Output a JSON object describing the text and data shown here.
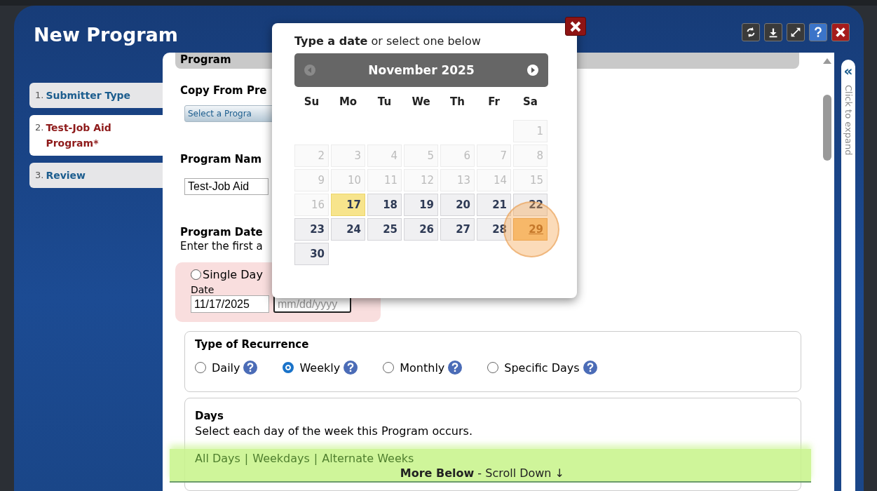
{
  "window": {
    "title": "New Program",
    "toolbar": [
      {
        "kind": "refresh"
      },
      {
        "kind": "download"
      },
      {
        "kind": "resize"
      },
      {
        "kind": "help"
      },
      {
        "kind": "close"
      }
    ]
  },
  "steps": [
    {
      "number": "1.",
      "label": "Submitter Type",
      "selected": false
    },
    {
      "number": "2.",
      "label": "Test-Job Aid Program*",
      "selected": true
    },
    {
      "number": "3.",
      "label": "Review",
      "selected": false
    }
  ],
  "form": {
    "section_title": "Program",
    "copy_from_label": "Copy From Pre",
    "copy_button": "Select a Progra",
    "name_label": "Program Nam",
    "name_value": "Test-Job Aid",
    "dates_label": "Program Date",
    "dates_hint": "Enter the first a",
    "single_day": {
      "label": "Single Day",
      "checked": false
    },
    "date_label": "Date",
    "date_value": "11/17/2025",
    "end_date_placeholder": "mm/dd/yyyy",
    "recurrence": {
      "title": "Type of Recurrence",
      "options": [
        {
          "label": "Daily",
          "selected": false
        },
        {
          "label": "Weekly",
          "selected": true
        },
        {
          "label": "Monthly",
          "selected": false
        },
        {
          "label": "Specific Days",
          "selected": false
        }
      ]
    },
    "days": {
      "title": "Days",
      "hint": "Select each day of the week this Program occurs.",
      "links": [
        "All Days",
        "Weekdays",
        "Alternate Weeks"
      ],
      "separator": "|"
    }
  },
  "scroll_hint": "**More Below** - Scroll Down ↓",
  "side_panel": {
    "icon": "«",
    "label": "Click to expand"
  },
  "date_picker": {
    "prompt": "**Type a date** or select one below",
    "month": "November 2025",
    "weekdays": [
      "Su",
      "Mo",
      "Tu",
      "We",
      "Th",
      "Fr",
      "Sa"
    ],
    "days": [
      {
        "kind": "blank"
      },
      {
        "kind": "blank"
      },
      {
        "kind": "blank"
      },
      {
        "kind": "blank"
      },
      {
        "kind": "blank"
      },
      {
        "kind": "blank"
      },
      {
        "kind": "day",
        "label": "1",
        "disabled": true,
        "today": false,
        "selected": false
      },
      {
        "kind": "day",
        "label": "2",
        "disabled": true,
        "today": false,
        "selected": false
      },
      {
        "kind": "day",
        "label": "3",
        "disabled": true,
        "today": false,
        "selected": false
      },
      {
        "kind": "day",
        "label": "4",
        "disabled": true,
        "today": false,
        "selected": false
      },
      {
        "kind": "day",
        "label": "5",
        "disabled": true,
        "today": false,
        "selected": false
      },
      {
        "kind": "day",
        "label": "6",
        "disabled": true,
        "today": false,
        "selected": false
      },
      {
        "kind": "day",
        "label": "7",
        "disabled": true,
        "today": false,
        "selected": false
      },
      {
        "kind": "day",
        "label": "8",
        "disabled": true,
        "today": false,
        "selected": false
      },
      {
        "kind": "day",
        "label": "9",
        "disabled": true,
        "today": false,
        "selected": false
      },
      {
        "kind": "day",
        "label": "10",
        "disabled": true,
        "today": false,
        "selected": false
      },
      {
        "kind": "day",
        "label": "11",
        "disabled": true,
        "today": false,
        "selected": false
      },
      {
        "kind": "day",
        "label": "12",
        "disabled": true,
        "today": false,
        "selected": false
      },
      {
        "kind": "day",
        "label": "13",
        "disabled": true,
        "today": false,
        "selected": false
      },
      {
        "kind": "day",
        "label": "14",
        "disabled": true,
        "today": false,
        "selected": false
      },
      {
        "kind": "day",
        "label": "15",
        "disabled": true,
        "today": false,
        "selected": false
      },
      {
        "kind": "day",
        "label": "16",
        "disabled": true,
        "today": false,
        "selected": false
      },
      {
        "kind": "day",
        "label": "17",
        "disabled": false,
        "today": true,
        "selected": false
      },
      {
        "kind": "day",
        "label": "18",
        "disabled": false,
        "today": false,
        "selected": false
      },
      {
        "kind": "day",
        "label": "19",
        "disabled": false,
        "today": false,
        "selected": false
      },
      {
        "kind": "day",
        "label": "20",
        "disabled": false,
        "today": false,
        "selected": false
      },
      {
        "kind": "day",
        "label": "21",
        "disabled": false,
        "today": false,
        "selected": false
      },
      {
        "kind": "day",
        "label": "22",
        "disabled": false,
        "today": false,
        "selected": false
      },
      {
        "kind": "day",
        "label": "23",
        "disabled": false,
        "today": false,
        "selected": false
      },
      {
        "kind": "day",
        "label": "24",
        "disabled": false,
        "today": false,
        "selected": false
      },
      {
        "kind": "day",
        "label": "25",
        "disabled": false,
        "today": false,
        "selected": false
      },
      {
        "kind": "day",
        "label": "26",
        "disabled": false,
        "today": false,
        "selected": false
      },
      {
        "kind": "day",
        "label": "27",
        "disabled": false,
        "today": false,
        "selected": false
      },
      {
        "kind": "day",
        "label": "28",
        "disabled": false,
        "today": false,
        "selected": false
      },
      {
        "kind": "day",
        "label": "29",
        "disabled": false,
        "today": false,
        "selected": true
      },
      {
        "kind": "day",
        "label": "30",
        "disabled": false,
        "today": false,
        "selected": false
      }
    ]
  }
}
